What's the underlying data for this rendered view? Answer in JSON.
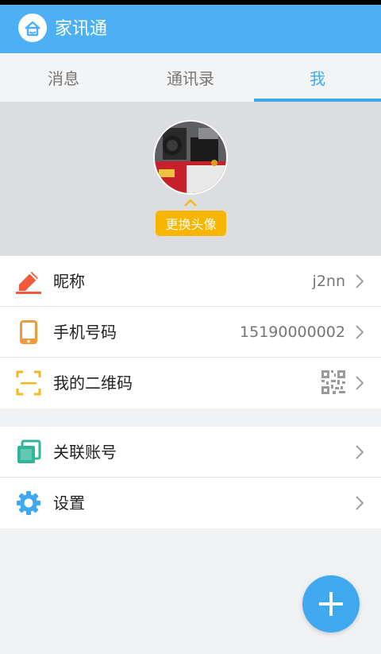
{
  "app": {
    "title": "家讯通"
  },
  "tabs": [
    {
      "label": "消息"
    },
    {
      "label": "通讯录"
    },
    {
      "label": "我",
      "active": true
    }
  ],
  "profile": {
    "change_avatar_label": "更换头像"
  },
  "settings_group1": [
    {
      "label": "昵称",
      "value": "j2nn",
      "icon": "pencil-icon"
    },
    {
      "label": "手机号码",
      "value": "15190000002",
      "icon": "phone-icon"
    },
    {
      "label": "我的二维码",
      "icon": "qr-scan-icon"
    }
  ],
  "settings_group2": [
    {
      "label": "关联账号",
      "icon": "linked-accounts-icon"
    },
    {
      "label": "设置",
      "icon": "gear-icon"
    }
  ],
  "colors": {
    "primary": "#4db0f5",
    "accent": "#3fa9f0",
    "badge": "#f7b500"
  },
  "fab": {
    "icon": "plus-icon"
  }
}
